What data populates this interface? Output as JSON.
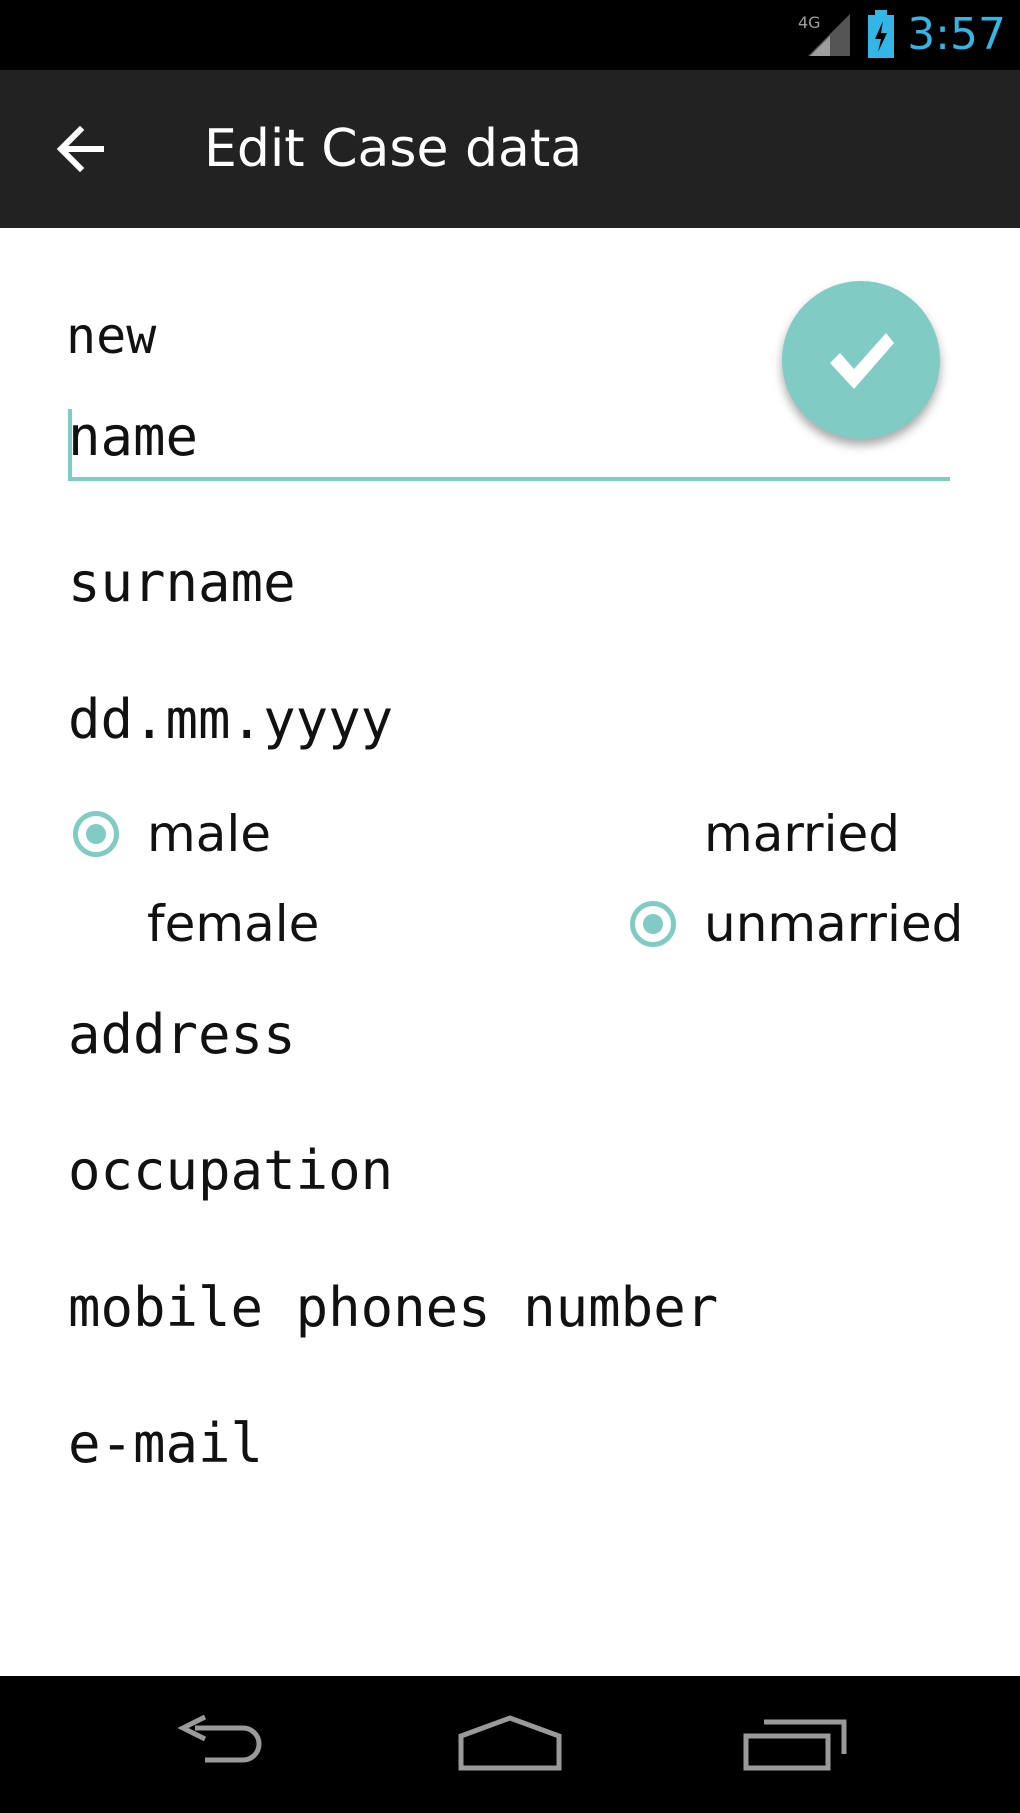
{
  "status_bar": {
    "network": "4G",
    "time": "3:57",
    "colors": {
      "background": "#000000",
      "clock": "#33b5e5"
    }
  },
  "action_bar": {
    "title": "Edit Case data",
    "back_icon": "arrow-left-icon"
  },
  "form": {
    "header": "new",
    "submit_icon": "checkmark-icon",
    "fields": {
      "name": {
        "placeholder": "name",
        "value": ""
      },
      "surname": {
        "placeholder": "surname",
        "value": ""
      },
      "birthdate": {
        "placeholder": "dd.mm.yyyy",
        "value": ""
      },
      "address": {
        "placeholder": "address",
        "value": ""
      },
      "occupation": {
        "placeholder": "occupation",
        "value": ""
      },
      "mobile": {
        "placeholder": "mobile phones number",
        "value": ""
      },
      "email": {
        "placeholder": "e-mail",
        "value": ""
      }
    },
    "gender": {
      "options": [
        "male",
        "female"
      ],
      "selected": "male"
    },
    "marital": {
      "options": [
        "married",
        "unmarried"
      ],
      "selected": "unmarried"
    },
    "colors": {
      "accent": "#80cbc4",
      "action_bar": "#222222"
    }
  },
  "nav_bar": {
    "back_icon": "nav-back-icon",
    "home_icon": "nav-home-icon",
    "recents_icon": "nav-recents-icon"
  }
}
